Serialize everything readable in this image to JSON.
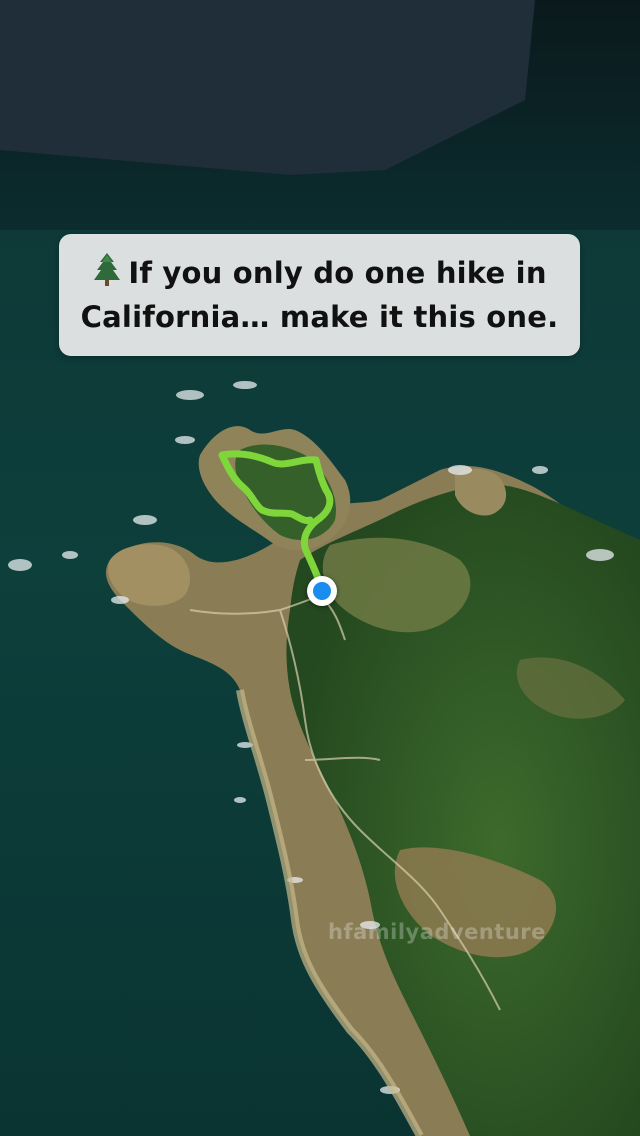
{
  "caption": {
    "icon": "evergreen-tree-icon",
    "text": "If you only do one hike in California… make it this one."
  },
  "watermark": {
    "text": "hfamilyadventure"
  },
  "map": {
    "view": "3d-satellite",
    "route_color": "#7ed63a",
    "pin_color": "#1a8cf0",
    "ocean_color": "#0d3b3a",
    "forest_color": "#2f5a26"
  }
}
